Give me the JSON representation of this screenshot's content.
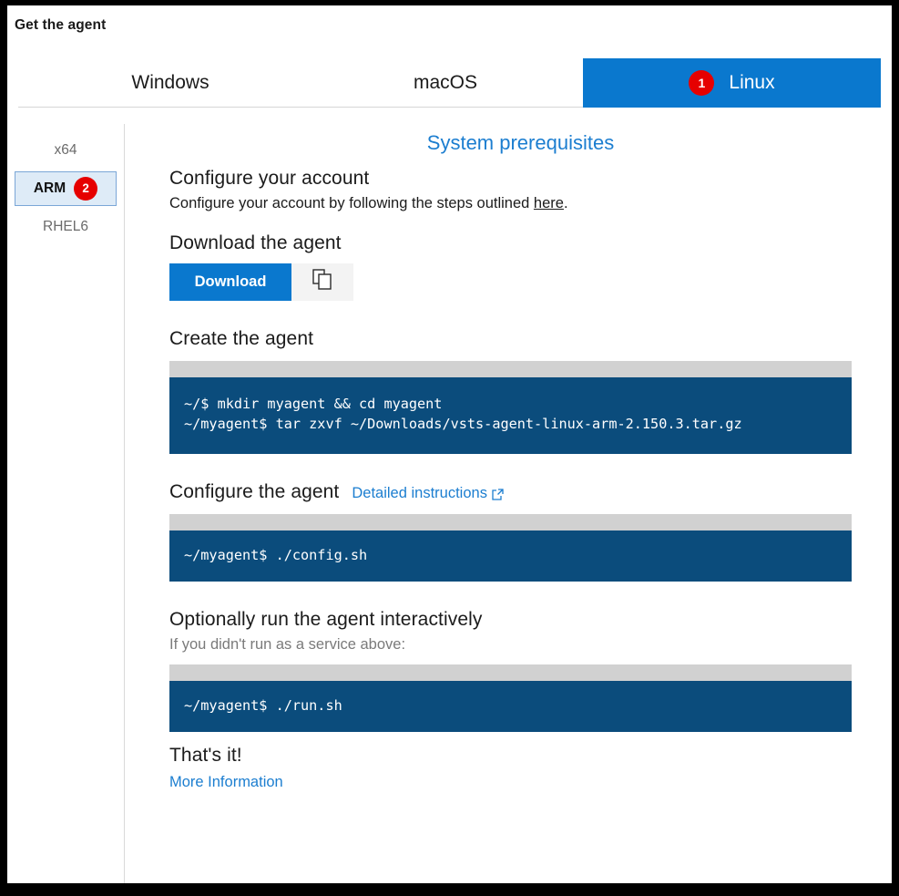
{
  "dialog": {
    "title": "Get the agent"
  },
  "tabs": [
    {
      "label": "Windows",
      "selected": false,
      "badge": null
    },
    {
      "label": "macOS",
      "selected": false,
      "badge": null
    },
    {
      "label": "Linux",
      "selected": true,
      "badge": "1"
    }
  ],
  "sidebar": {
    "items": [
      {
        "label": "x64",
        "selected": false,
        "badge": null
      },
      {
        "label": "ARM",
        "selected": true,
        "badge": "2"
      },
      {
        "label": "RHEL6",
        "selected": false,
        "badge": null
      }
    ]
  },
  "content": {
    "prerequisites_link": "System prerequisites",
    "configure_account": {
      "heading": "Configure your account",
      "text_before": "Configure your account by following the steps outlined ",
      "link": "here",
      "text_after": "."
    },
    "download": {
      "heading": "Download the agent",
      "button_label": "Download",
      "copy_icon": "copy-icon"
    },
    "create_agent": {
      "heading": "Create the agent",
      "lines": [
        "~/$ mkdir myagent && cd myagent",
        "~/myagent$ tar zxvf ~/Downloads/vsts-agent-linux-arm-2.150.3.tar.gz"
      ]
    },
    "configure_agent": {
      "heading": "Configure the agent",
      "detail_link": "Detailed instructions",
      "detail_icon": "external-link-icon",
      "lines": [
        "~/myagent$ ./config.sh"
      ]
    },
    "run_interactively": {
      "heading": "Optionally run the agent interactively",
      "subtext": "If you didn't run as a service above:",
      "lines": [
        "~/myagent$ ./run.sh"
      ]
    },
    "finish": {
      "heading": "That's it!",
      "more_info_link": "More Information"
    }
  },
  "colors": {
    "accent_blue": "#0a78ce",
    "link_blue": "#1c7ed0",
    "code_bg": "#0b4c7c",
    "code_bar": "#d1d1d1",
    "badge_red": "#e60000",
    "selected_bg": "#deebf7",
    "selected_border": "#7ba7d7"
  }
}
